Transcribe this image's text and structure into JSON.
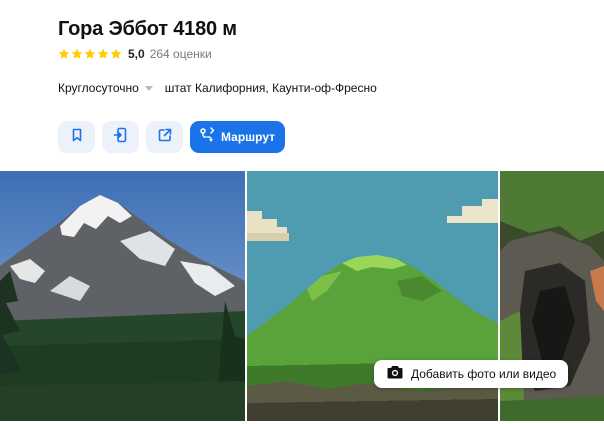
{
  "place": {
    "title": "Гора Эббот 4180 м",
    "rating_value": "5,0",
    "rating_stars": 5,
    "reviews_count": "264 оценки"
  },
  "info": {
    "hours": "Круглосуточно",
    "address": "штат Калифорния, Каунти-оф-Фресно"
  },
  "actions": {
    "bookmark_icon": "bookmark-icon",
    "send_to_phone_icon": "send-to-phone-icon",
    "share_icon": "share-icon",
    "route_icon": "route-icon",
    "route_label": "Маршрут"
  },
  "gallery": {
    "add_media_icon": "camera-icon",
    "add_media_label": "Добавить фото или видео"
  },
  "colors": {
    "accent": "#1a73e8",
    "star": "#ffcc00",
    "icon_button_bg": "#edf2fa"
  }
}
